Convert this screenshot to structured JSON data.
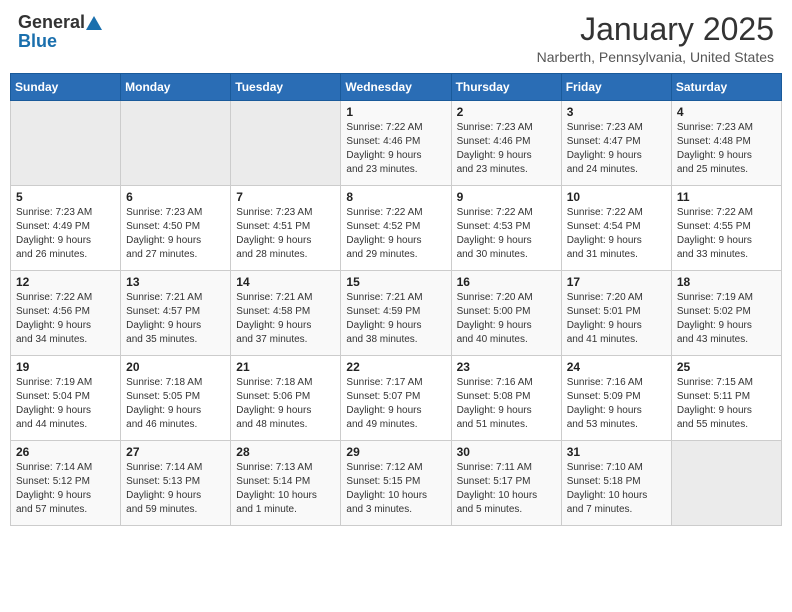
{
  "header": {
    "logo_general": "General",
    "logo_blue": "Blue",
    "month": "January 2025",
    "location": "Narberth, Pennsylvania, United States"
  },
  "weekdays": [
    "Sunday",
    "Monday",
    "Tuesday",
    "Wednesday",
    "Thursday",
    "Friday",
    "Saturday"
  ],
  "weeks": [
    [
      {
        "day": "",
        "info": ""
      },
      {
        "day": "",
        "info": ""
      },
      {
        "day": "",
        "info": ""
      },
      {
        "day": "1",
        "info": "Sunrise: 7:22 AM\nSunset: 4:46 PM\nDaylight: 9 hours\nand 23 minutes."
      },
      {
        "day": "2",
        "info": "Sunrise: 7:23 AM\nSunset: 4:46 PM\nDaylight: 9 hours\nand 23 minutes."
      },
      {
        "day": "3",
        "info": "Sunrise: 7:23 AM\nSunset: 4:47 PM\nDaylight: 9 hours\nand 24 minutes."
      },
      {
        "day": "4",
        "info": "Sunrise: 7:23 AM\nSunset: 4:48 PM\nDaylight: 9 hours\nand 25 minutes."
      }
    ],
    [
      {
        "day": "5",
        "info": "Sunrise: 7:23 AM\nSunset: 4:49 PM\nDaylight: 9 hours\nand 26 minutes."
      },
      {
        "day": "6",
        "info": "Sunrise: 7:23 AM\nSunset: 4:50 PM\nDaylight: 9 hours\nand 27 minutes."
      },
      {
        "day": "7",
        "info": "Sunrise: 7:23 AM\nSunset: 4:51 PM\nDaylight: 9 hours\nand 28 minutes."
      },
      {
        "day": "8",
        "info": "Sunrise: 7:22 AM\nSunset: 4:52 PM\nDaylight: 9 hours\nand 29 minutes."
      },
      {
        "day": "9",
        "info": "Sunrise: 7:22 AM\nSunset: 4:53 PM\nDaylight: 9 hours\nand 30 minutes."
      },
      {
        "day": "10",
        "info": "Sunrise: 7:22 AM\nSunset: 4:54 PM\nDaylight: 9 hours\nand 31 minutes."
      },
      {
        "day": "11",
        "info": "Sunrise: 7:22 AM\nSunset: 4:55 PM\nDaylight: 9 hours\nand 33 minutes."
      }
    ],
    [
      {
        "day": "12",
        "info": "Sunrise: 7:22 AM\nSunset: 4:56 PM\nDaylight: 9 hours\nand 34 minutes."
      },
      {
        "day": "13",
        "info": "Sunrise: 7:21 AM\nSunset: 4:57 PM\nDaylight: 9 hours\nand 35 minutes."
      },
      {
        "day": "14",
        "info": "Sunrise: 7:21 AM\nSunset: 4:58 PM\nDaylight: 9 hours\nand 37 minutes."
      },
      {
        "day": "15",
        "info": "Sunrise: 7:21 AM\nSunset: 4:59 PM\nDaylight: 9 hours\nand 38 minutes."
      },
      {
        "day": "16",
        "info": "Sunrise: 7:20 AM\nSunset: 5:00 PM\nDaylight: 9 hours\nand 40 minutes."
      },
      {
        "day": "17",
        "info": "Sunrise: 7:20 AM\nSunset: 5:01 PM\nDaylight: 9 hours\nand 41 minutes."
      },
      {
        "day": "18",
        "info": "Sunrise: 7:19 AM\nSunset: 5:02 PM\nDaylight: 9 hours\nand 43 minutes."
      }
    ],
    [
      {
        "day": "19",
        "info": "Sunrise: 7:19 AM\nSunset: 5:04 PM\nDaylight: 9 hours\nand 44 minutes."
      },
      {
        "day": "20",
        "info": "Sunrise: 7:18 AM\nSunset: 5:05 PM\nDaylight: 9 hours\nand 46 minutes."
      },
      {
        "day": "21",
        "info": "Sunrise: 7:18 AM\nSunset: 5:06 PM\nDaylight: 9 hours\nand 48 minutes."
      },
      {
        "day": "22",
        "info": "Sunrise: 7:17 AM\nSunset: 5:07 PM\nDaylight: 9 hours\nand 49 minutes."
      },
      {
        "day": "23",
        "info": "Sunrise: 7:16 AM\nSunset: 5:08 PM\nDaylight: 9 hours\nand 51 minutes."
      },
      {
        "day": "24",
        "info": "Sunrise: 7:16 AM\nSunset: 5:09 PM\nDaylight: 9 hours\nand 53 minutes."
      },
      {
        "day": "25",
        "info": "Sunrise: 7:15 AM\nSunset: 5:11 PM\nDaylight: 9 hours\nand 55 minutes."
      }
    ],
    [
      {
        "day": "26",
        "info": "Sunrise: 7:14 AM\nSunset: 5:12 PM\nDaylight: 9 hours\nand 57 minutes."
      },
      {
        "day": "27",
        "info": "Sunrise: 7:14 AM\nSunset: 5:13 PM\nDaylight: 9 hours\nand 59 minutes."
      },
      {
        "day": "28",
        "info": "Sunrise: 7:13 AM\nSunset: 5:14 PM\nDaylight: 10 hours\nand 1 minute."
      },
      {
        "day": "29",
        "info": "Sunrise: 7:12 AM\nSunset: 5:15 PM\nDaylight: 10 hours\nand 3 minutes."
      },
      {
        "day": "30",
        "info": "Sunrise: 7:11 AM\nSunset: 5:17 PM\nDaylight: 10 hours\nand 5 minutes."
      },
      {
        "day": "31",
        "info": "Sunrise: 7:10 AM\nSunset: 5:18 PM\nDaylight: 10 hours\nand 7 minutes."
      },
      {
        "day": "",
        "info": ""
      }
    ]
  ]
}
